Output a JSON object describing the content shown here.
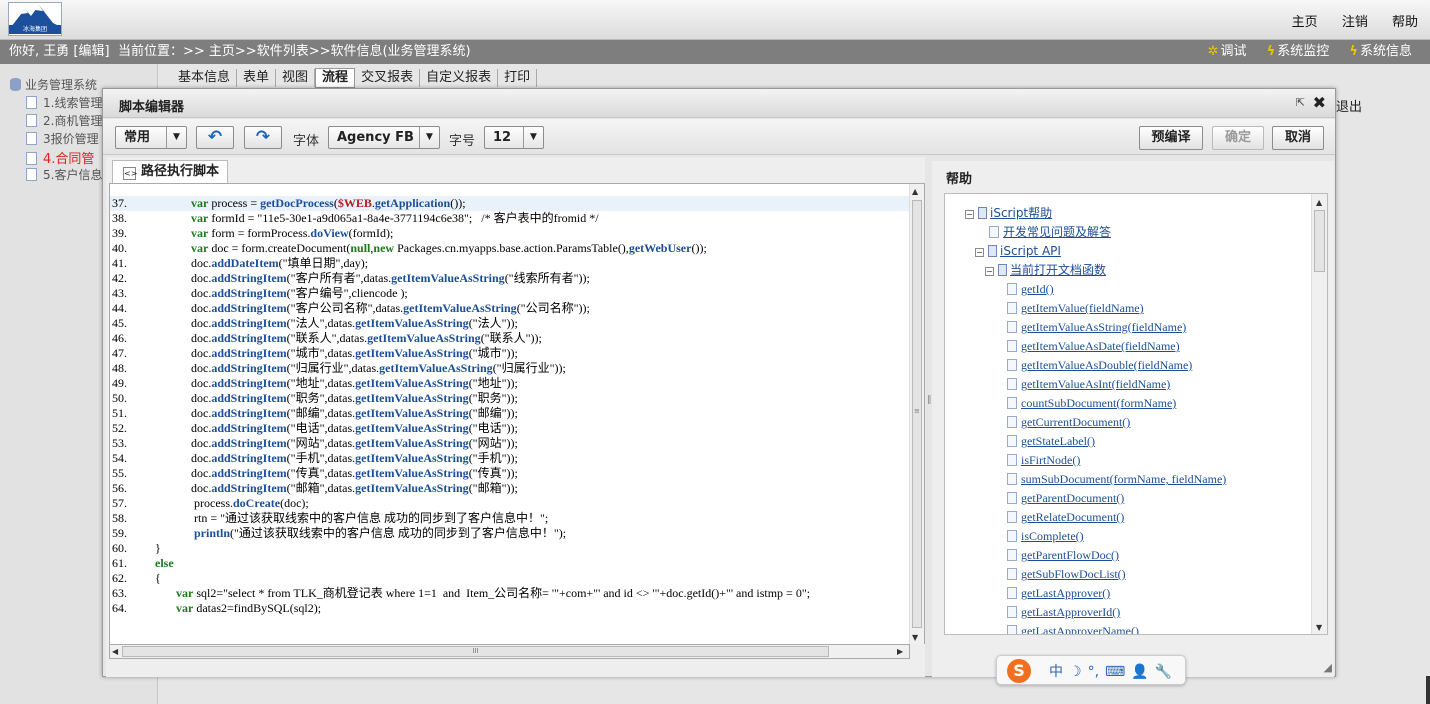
{
  "topbar": {
    "logo_text": "冰海集团",
    "nav": [
      "主页",
      "注销",
      "帮助"
    ]
  },
  "infobar": {
    "user": "你好, 王勇 [编辑]",
    "breadcrumb": "当前位置：>> 主页>>软件列表>>软件信息(业务管理系统)",
    "tools": [
      {
        "icon": "debug-icon",
        "label": "调试"
      },
      {
        "icon": "lightning-icon",
        "label": "系统监控"
      },
      {
        "icon": "lightning-icon",
        "label": "系统信息"
      }
    ]
  },
  "sidebar": {
    "root": "业务管理系统",
    "items": [
      "1.线索管理",
      "2.商机管理",
      "3报价管理",
      "4.合同管",
      "5.客户信息"
    ],
    "active_index": 3
  },
  "tabs": [
    "基本信息",
    "表单",
    "视图",
    "流程",
    "交叉报表",
    "自定义报表",
    "打印"
  ],
  "selected_tab": "流程",
  "exit_label": "退出",
  "dialog": {
    "title": "脚本编辑器",
    "toolbar": {
      "mode": "常用",
      "font_label": "字体",
      "font_value": "Agency FB",
      "size_label": "字号",
      "size_value": "12",
      "precompile": "预编译",
      "confirm": "确定",
      "cancel": "取消"
    },
    "editor_tab": "路径执行脚本",
    "help_title": "帮助"
  },
  "code_lines": [
    {
      "n": "37.",
      "t": "            var process = getDocProcess($WEB.getApplication());"
    },
    {
      "n": "38.",
      "t": "            var formId = \"11e5-30e1-a9d065a1-8a4e-3771194c6e38\";   /* 客户表中的fromid */"
    },
    {
      "n": "39.",
      "t": "            var form = formProcess.doView(formId);"
    },
    {
      "n": "40.",
      "t": "            var doc = form.createDocument(null,new Packages.cn.myapps.base.action.ParamsTable(),getWebUser());"
    },
    {
      "n": "41.",
      "t": "            doc.addDateItem(\"填单日期\",day);"
    },
    {
      "n": "42.",
      "t": "            doc.addStringItem(\"客户所有者\",datas.getItemValueAsString(\"线索所有者\"));"
    },
    {
      "n": "43.",
      "t": "            doc.addStringItem(\"客户编号\",cliencode );"
    },
    {
      "n": "44.",
      "t": "            doc.addStringItem(\"客户公司名称\",datas.getItemValueAsString(\"公司名称\"));"
    },
    {
      "n": "45.",
      "t": "            doc.addStringItem(\"法人\",datas.getItemValueAsString(\"法人\"));"
    },
    {
      "n": "46.",
      "t": "            doc.addStringItem(\"联系人\",datas.getItemValueAsString(\"联系人\"));"
    },
    {
      "n": "47.",
      "t": "            doc.addStringItem(\"城市\",datas.getItemValueAsString(\"城市\"));"
    },
    {
      "n": "48.",
      "t": "            doc.addStringItem(\"归属行业\",datas.getItemValueAsString(\"归属行业\"));"
    },
    {
      "n": "49.",
      "t": "            doc.addStringItem(\"地址\",datas.getItemValueAsString(\"地址\"));"
    },
    {
      "n": "50.",
      "t": "            doc.addStringItem(\"职务\",datas.getItemValueAsString(\"职务\"));"
    },
    {
      "n": "51.",
      "t": "            doc.addStringItem(\"邮编\",datas.getItemValueAsString(\"邮编\"));"
    },
    {
      "n": "52.",
      "t": "            doc.addStringItem(\"电话\",datas.getItemValueAsString(\"电话\"));"
    },
    {
      "n": "53.",
      "t": "            doc.addStringItem(\"网站\",datas.getItemValueAsString(\"网站\"));"
    },
    {
      "n": "54.",
      "t": "            doc.addStringItem(\"手机\",datas.getItemValueAsString(\"手机\"));"
    },
    {
      "n": "55.",
      "t": "            doc.addStringItem(\"传真\",datas.getItemValueAsString(\"传真\"));"
    },
    {
      "n": "56.",
      "t": "            doc.addStringItem(\"邮箱\",datas.getItemValueAsString(\"邮箱\"));"
    },
    {
      "n": "57.",
      "t": "             process.doCreate(doc);"
    },
    {
      "n": "58.",
      "t": "             rtn = \"通过该获取线索中的客户信息 成功的同步到了客户信息中！\";"
    },
    {
      "n": "59.",
      "t": "             println(\"通过该获取线索中的客户信息 成功的同步到了客户信息中！\");"
    },
    {
      "n": "60.",
      "t": "}"
    },
    {
      "n": "61.",
      "t": "else"
    },
    {
      "n": "62.",
      "t": "{"
    },
    {
      "n": "63.",
      "t": "       var sql2=\"select * from TLK_商机登记表 where 1=1  and  Item_公司名称= '\"+com+\"' and id <> '\"+doc.getId()+\"' and istmp = 0\";"
    },
    {
      "n": "64.",
      "t": "       var datas2=findBySQL(sql2);"
    }
  ],
  "help_tree": [
    {
      "label": "iScript帮助",
      "depth": 0,
      "kind": "book",
      "toggle": "−"
    },
    {
      "label": "开发常见问题及解答",
      "depth": 1,
      "kind": "page",
      "toggle": ""
    },
    {
      "label": "iScript API",
      "depth": 1,
      "kind": "book",
      "toggle": "−"
    },
    {
      "label": "当前打开文档函数",
      "depth": 2,
      "kind": "book",
      "toggle": "−"
    },
    {
      "label": "getId()",
      "depth": 3,
      "kind": "page",
      "toggle": ""
    },
    {
      "label": "getItemValue(fieldName)",
      "depth": 3,
      "kind": "page",
      "toggle": ""
    },
    {
      "label": "getItemValueAsString(fieldName)",
      "depth": 3,
      "kind": "page",
      "toggle": ""
    },
    {
      "label": "getItemValueAsDate(fieldName)",
      "depth": 3,
      "kind": "page",
      "toggle": ""
    },
    {
      "label": "getItemValueAsDouble(fieldName)",
      "depth": 3,
      "kind": "page",
      "toggle": ""
    },
    {
      "label": "getItemValueAsInt(fieldName)",
      "depth": 3,
      "kind": "page",
      "toggle": ""
    },
    {
      "label": "countSubDocument(formName)",
      "depth": 3,
      "kind": "page",
      "toggle": ""
    },
    {
      "label": "getCurrentDocument()",
      "depth": 3,
      "kind": "page",
      "toggle": ""
    },
    {
      "label": "getStateLabel()",
      "depth": 3,
      "kind": "page",
      "toggle": ""
    },
    {
      "label": "isFirtNode()",
      "depth": 3,
      "kind": "page",
      "toggle": ""
    },
    {
      "label": "sumSubDocument(formName, fieldName)",
      "depth": 3,
      "kind": "page",
      "toggle": ""
    },
    {
      "label": "getParentDocument()",
      "depth": 3,
      "kind": "page",
      "toggle": ""
    },
    {
      "label": "getRelateDocument()",
      "depth": 3,
      "kind": "page",
      "toggle": ""
    },
    {
      "label": "isComplete()",
      "depth": 3,
      "kind": "page",
      "toggle": ""
    },
    {
      "label": "getParentFlowDoc()",
      "depth": 3,
      "kind": "page",
      "toggle": ""
    },
    {
      "label": "getSubFlowDocList()",
      "depth": 3,
      "kind": "page",
      "toggle": ""
    },
    {
      "label": "getLastApprover()",
      "depth": 3,
      "kind": "page",
      "toggle": ""
    },
    {
      "label": "getLastApproverId()",
      "depth": 3,
      "kind": "page",
      "toggle": ""
    },
    {
      "label": "getLastApproverName()",
      "depth": 3,
      "kind": "page",
      "toggle": ""
    }
  ],
  "ime": {
    "logo": "S",
    "items": [
      "中",
      "☽",
      "°,",
      "⌨",
      "👤",
      "🔧"
    ]
  },
  "colors": {
    "accent": "#1e67b8",
    "active_item": "#e02020",
    "link": "#1c4e96",
    "keyword": "#1a7a1a"
  }
}
